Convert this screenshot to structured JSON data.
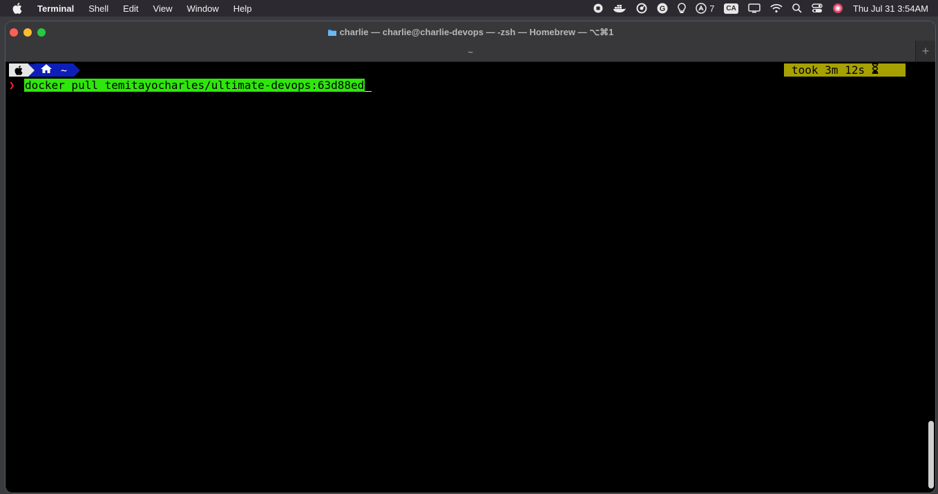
{
  "menubar": {
    "app_name": "Terminal",
    "menus": [
      "Shell",
      "Edit",
      "View",
      "Window",
      "Help"
    ],
    "status": {
      "badge_count": "7",
      "input_source": "CA",
      "datetime": "Thu Jul 31  3:54AM"
    }
  },
  "window": {
    "title": "charlie — charlie@charlie-devops — -zsh — Homebrew — ⌥⌘1",
    "tab_label": "~",
    "new_tab_symbol": "+"
  },
  "terminal": {
    "prompt_dir": "~",
    "took": "took 3m 12s",
    "command": "docker pull temitayocharles/ultimate-devops:63d88ed",
    "colors": {
      "apple_segment": "#e6e6e6",
      "dir_segment": "#0d1fb8",
      "took_segment": "#a6a100",
      "command_highlight": "#2fe60c",
      "prompt_chevron": "#ff2a2a"
    }
  }
}
